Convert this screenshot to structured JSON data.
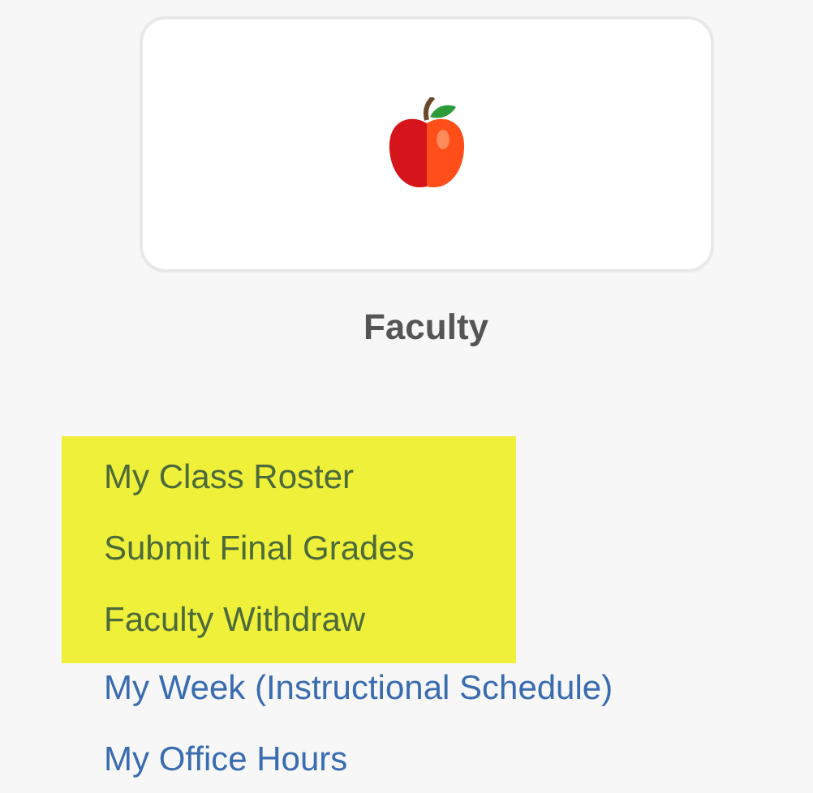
{
  "tile": {
    "label": "Faculty"
  },
  "links": [
    {
      "label": "My Class Roster",
      "highlighted": true
    },
    {
      "label": "Submit Final Grades",
      "highlighted": true
    },
    {
      "label": "Faculty Withdraw",
      "highlighted": true
    },
    {
      "label": "My Week (Instructional Schedule)",
      "highlighted": false
    },
    {
      "label": "My Office Hours",
      "highlighted": false
    }
  ]
}
